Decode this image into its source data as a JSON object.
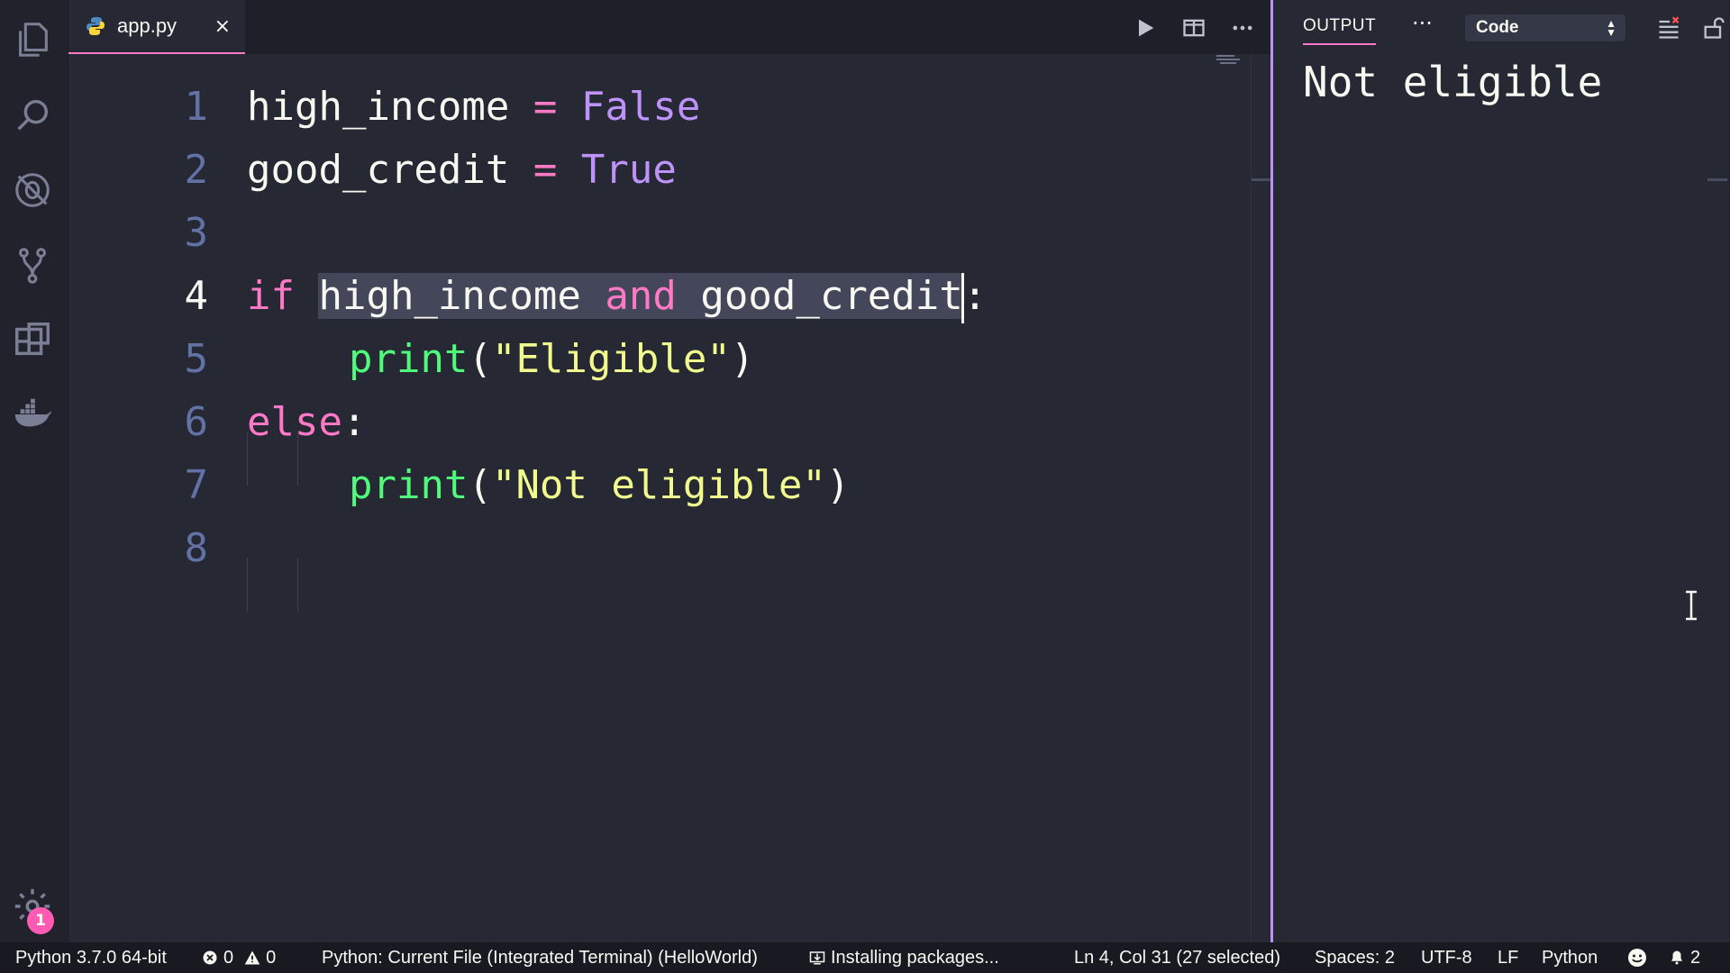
{
  "tab": {
    "filename": "app.py",
    "close": "×"
  },
  "editor": {
    "line_numbers": [
      "1",
      "2",
      "3",
      "4",
      "5",
      "6",
      "7",
      "8"
    ],
    "line1": {
      "var": "high_income",
      "op": " = ",
      "const": "False"
    },
    "line2": {
      "var": "good_credit",
      "op": " = ",
      "const": "True"
    },
    "line4": {
      "kw": "if",
      "sp": " ",
      "a": "high_income",
      "sp2": " ",
      "and": "and",
      "sp3": " ",
      "b": "good_credit",
      "colon": ":"
    },
    "line5": {
      "fn": "print",
      "open": "(",
      "str": "\"Eligible\"",
      "close": ")"
    },
    "line6": {
      "kw": "else",
      "colon": ":"
    },
    "line7": {
      "fn": "print",
      "open": "(",
      "str": "\"Not eligible\"",
      "close": ")"
    }
  },
  "panel": {
    "tab_label": "OUTPUT",
    "more": "···",
    "select_value": "Code",
    "output": "Not eligible"
  },
  "activity": {
    "badge": "1"
  },
  "status": {
    "interpreter": "Python 3.7.0 64-bit",
    "errors": "0",
    "warnings": "0",
    "debug_config": "Python: Current File (Integrated Terminal) (HelloWorld)",
    "task": "Installing packages...",
    "cursor": "Ln 4, Col 31 (27 selected)",
    "spaces": "Spaces: 2",
    "encoding": "UTF-8",
    "eol": "LF",
    "language": "Python",
    "notifications": "2"
  },
  "colors": {
    "accent": "#ff79c6",
    "purple": "#bd93f9",
    "green": "#50fa7b",
    "yellow": "#f1fa8c",
    "background": "#262833"
  }
}
